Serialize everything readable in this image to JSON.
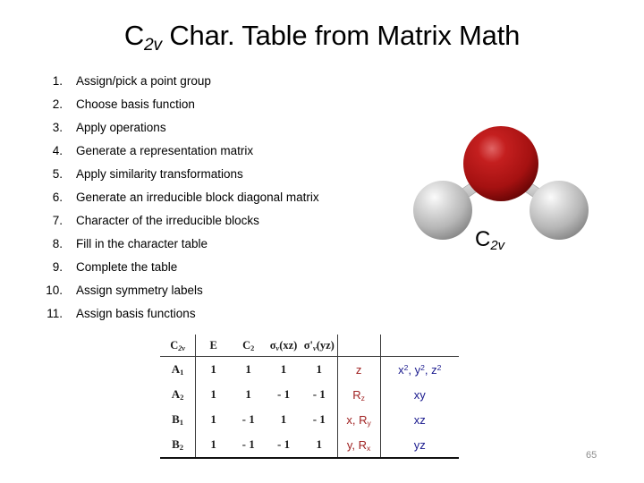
{
  "slide": {
    "title_main": "Char. Table from Matrix Math",
    "title_symbol": "C",
    "title_symbol_sub": "2v",
    "page_number": "65",
    "background_color": "#ffffff"
  },
  "steps": {
    "items": [
      {
        "number": "1.",
        "text": "Assign/pick a point group"
      },
      {
        "number": "2.",
        "text": "Choose basis function"
      },
      {
        "number": "3.",
        "text": "Apply operations"
      },
      {
        "number": "4.",
        "text": "Generate a representation matrix"
      },
      {
        "number": "5.",
        "text": "Apply similarity transformations"
      },
      {
        "number": "6.",
        "text": "Generate an irreducible block diagonal matrix"
      },
      {
        "number": "7.",
        "text": "Character of the irreducible blocks"
      },
      {
        "number": "8.",
        "text": "Fill in the character table"
      },
      {
        "number": "9.",
        "text": "Complete the table"
      },
      {
        "number": "10.",
        "text": "Assign symmetry labels"
      },
      {
        "number": "11.",
        "text": "Assign basis functions"
      }
    ]
  },
  "molecule": {
    "name": "water-molecule-ball-and-stick",
    "formula": "H2O",
    "label_symbol": "C",
    "label_sub": "2v",
    "atoms": [
      {
        "element": "O",
        "role": "central-oxygen",
        "color": "#b01515"
      },
      {
        "element": "H",
        "role": "hydrogen-left",
        "color": "#bdbdbd"
      },
      {
        "element": "H",
        "role": "hydrogen-right",
        "color": "#bdbdbd"
      }
    ],
    "bond_color": "#c8c8c8"
  },
  "char_table": {
    "corner_label_symbol": "C",
    "corner_label_sub": "2v",
    "operations": [
      {
        "symbol": "E",
        "sub": "",
        "paren": ""
      },
      {
        "symbol": "C",
        "sub": "2",
        "paren": ""
      },
      {
        "symbol": "σ",
        "sub": "v",
        "paren": "(xz)"
      },
      {
        "symbol": "σ'",
        "sub": "v",
        "paren": "(yz)"
      }
    ],
    "extra_headers": [
      "",
      ""
    ],
    "rows": [
      {
        "label_main": "A",
        "label_sub": "1",
        "characters": [
          "1",
          "1",
          "1",
          "1"
        ],
        "linear": "z",
        "linear_parts": [
          {
            "text": "z",
            "sub": ""
          }
        ],
        "quadratic_parts": [
          {
            "base": "x",
            "sup": "2"
          },
          {
            "base": "y",
            "sup": "2"
          },
          {
            "base": "z",
            "sup": "2"
          }
        ]
      },
      {
        "label_main": "A",
        "label_sub": "2",
        "characters": [
          "1",
          "1",
          "- 1",
          "- 1"
        ],
        "linear": "Rz",
        "linear_parts": [
          {
            "text": "R",
            "sub": "z"
          }
        ],
        "quadratic_parts": [
          {
            "base": "xy",
            "sup": ""
          }
        ]
      },
      {
        "label_main": "B",
        "label_sub": "1",
        "characters": [
          "1",
          "- 1",
          "1",
          "- 1"
        ],
        "linear": "x, Ry",
        "linear_parts": [
          {
            "text": "x,",
            "sub": ""
          },
          {
            "text": "R",
            "sub": "y"
          }
        ],
        "quadratic_parts": [
          {
            "base": "xz",
            "sup": ""
          }
        ]
      },
      {
        "label_main": "B",
        "label_sub": "2",
        "characters": [
          "1",
          "- 1",
          "- 1",
          "1"
        ],
        "linear": "y, Rx",
        "linear_parts": [
          {
            "text": "y,",
            "sub": ""
          },
          {
            "text": "R",
            "sub": "x"
          }
        ],
        "quadratic_parts": [
          {
            "base": "yz",
            "sup": ""
          }
        ]
      }
    ],
    "colors": {
      "characters": "#1d1d1d",
      "linear_basis": "#a02222",
      "quadratic_basis": "#1b1b8e",
      "rule": "#3a3a3a"
    }
  }
}
